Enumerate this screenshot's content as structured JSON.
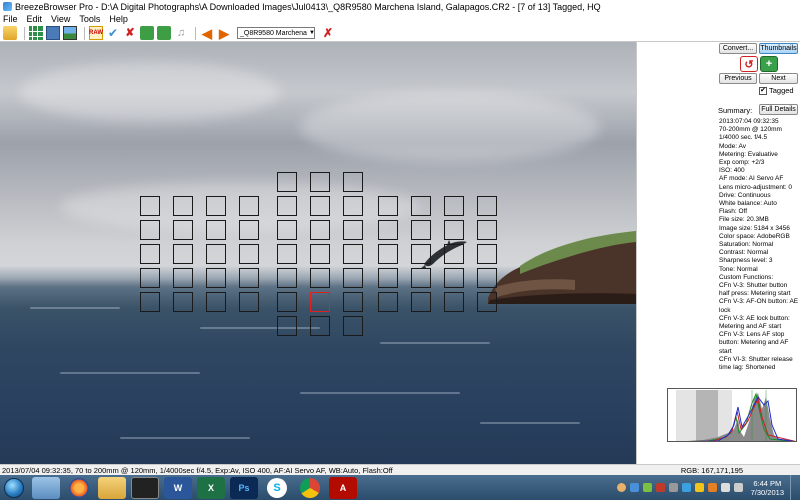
{
  "window": {
    "title": "BreezeBrowser Pro - D:\\A Digital Photographs\\A Downloaded Images\\Jul0413\\_Q8R9580   Marchena Island, Galapagos.CR2 - [7 of 13] Tagged, HQ"
  },
  "menu": [
    "File",
    "Edit",
    "View",
    "Tools",
    "Help"
  ],
  "toolbar": {
    "raw_label": "RAW",
    "file_selector_value": "_Q8R9580   Marchena"
  },
  "sidebar": {
    "convert_label": "Convert...",
    "thumbnails_label": "Thumbnails",
    "previous_label": "Previous",
    "next_label": "Next",
    "tagged_label": "Tagged",
    "tagged_checked": true,
    "summary_label": "Summary:",
    "full_details_label": "Full Details",
    "info": [
      "2013:07:04 09:32:35",
      "70-200mm @ 120mm",
      "1/4000 sec. f/4.5",
      "Mode: Av",
      "Metering: Evaluative",
      "Exp comp: +2/3",
      "ISO: 400",
      "AF mode: AI Servo AF",
      "Lens micro-adjustment: 0",
      "Drive: Continuous",
      "White balance: Auto",
      "Flash: Off",
      "File size: 20.3MB",
      "Image size: 5184 x 3456",
      "Color space: AdobeRGB",
      "Saturation: Normal",
      "Contrast: Normal",
      "Sharpness level: 3",
      "Tone: Normal",
      "Custom Functions:",
      "CFn V-3: Shutter button half press: Metering start",
      "CFn V-3: AF-ON button: AE lock",
      "CFn V-3: AE lock button: Metering and AF start",
      "CFn V-3: Lens AF stop button: Metering and AF start",
      "CFn VI-3: Shutter release time lag: Shortened"
    ]
  },
  "status": {
    "left": "2013/07/04 09:32:35, 70 to 200mm @ 120mm, 1/4000sec f/4.5, Exp:Av, ISO 400, AF:AI Servo AF, WB:Auto, Flash:Off",
    "right": "RGB: 167,171,195"
  },
  "taskbar": {
    "apps": [
      "explorer",
      "firefox",
      "folder",
      "camera",
      "word",
      "excel",
      "photoshop",
      "skype",
      "chrome",
      "acrobat"
    ],
    "time": "6:44 PM",
    "date": "7/30/2013"
  },
  "colors": {
    "af_active": "#e02020",
    "sky": "#c5c8cd",
    "ocean": "#2f4761",
    "taskbar": "#3a5d7d"
  }
}
